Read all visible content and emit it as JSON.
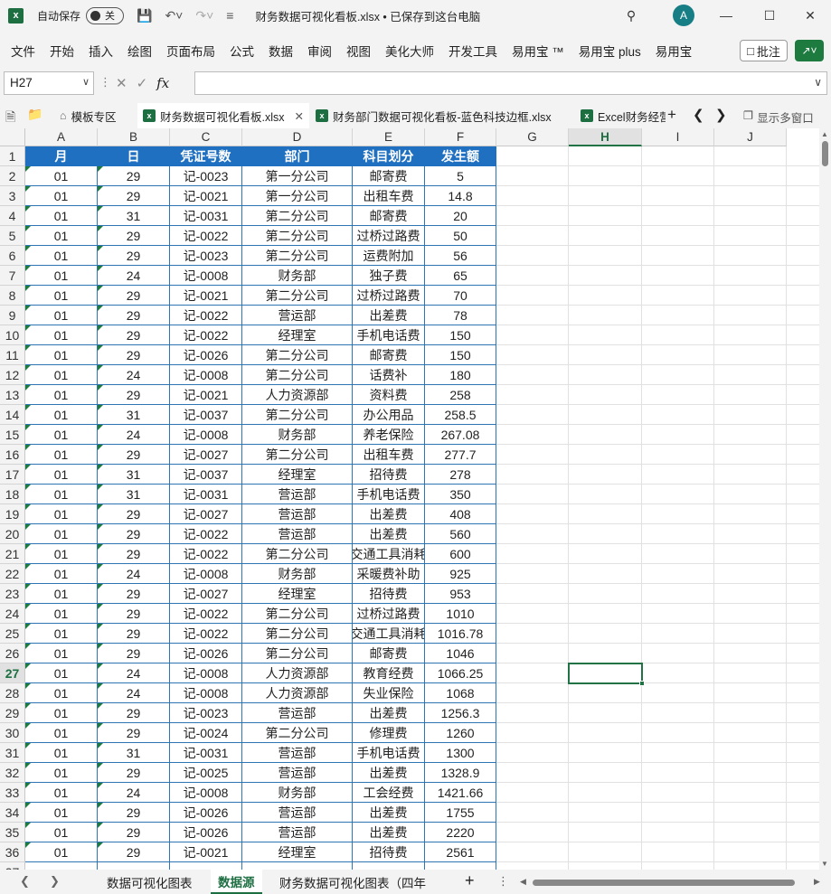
{
  "titlebar": {
    "autosave_label": "自动保存",
    "autosave_state": "关",
    "doc_title": "财务数据可视化看板.xlsx • 已保存到这台电脑",
    "avatar_letter": "A"
  },
  "menu": [
    "文件",
    "开始",
    "插入",
    "绘图",
    "页面布局",
    "公式",
    "数据",
    "审阅",
    "视图",
    "美化大师",
    "开发工具",
    "易用宝 ™",
    "易用宝 plus",
    "易用宝"
  ],
  "comment_label": "批注",
  "namebox": "H27",
  "fx_label": "fx",
  "file_tabs": {
    "template": "模板专区",
    "tab1": "财务数据可视化看板.xlsx",
    "tab2": "财务部门数据可视化看板-蓝色科技边框.xlsx",
    "tab3": "Excel财务经营",
    "multi_window": "显示多窗口"
  },
  "columns": [
    "A",
    "B",
    "C",
    "D",
    "E",
    "F",
    "G",
    "H",
    "I",
    "J"
  ],
  "headers": [
    "月",
    "日",
    "凭证号数",
    "部门",
    "科目划分",
    "发生额"
  ],
  "rows": [
    [
      "01",
      "29",
      "记-0023",
      "第一分公司",
      "邮寄费",
      "5"
    ],
    [
      "01",
      "29",
      "记-0021",
      "第一分公司",
      "出租车费",
      "14.8"
    ],
    [
      "01",
      "31",
      "记-0031",
      "第二分公司",
      "邮寄费",
      "20"
    ],
    [
      "01",
      "29",
      "记-0022",
      "第二分公司",
      "过桥过路费",
      "50"
    ],
    [
      "01",
      "29",
      "记-0023",
      "第二分公司",
      "运费附加",
      "56"
    ],
    [
      "01",
      "24",
      "记-0008",
      "财务部",
      "独子费",
      "65"
    ],
    [
      "01",
      "29",
      "记-0021",
      "第二分公司",
      "过桥过路费",
      "70"
    ],
    [
      "01",
      "29",
      "记-0022",
      "营运部",
      "出差费",
      "78"
    ],
    [
      "01",
      "29",
      "记-0022",
      "经理室",
      "手机电话费",
      "150"
    ],
    [
      "01",
      "29",
      "记-0026",
      "第二分公司",
      "邮寄费",
      "150"
    ],
    [
      "01",
      "24",
      "记-0008",
      "第二分公司",
      "话费补",
      "180"
    ],
    [
      "01",
      "29",
      "记-0021",
      "人力资源部",
      "资料费",
      "258"
    ],
    [
      "01",
      "31",
      "记-0037",
      "第二分公司",
      "办公用品",
      "258.5"
    ],
    [
      "01",
      "24",
      "记-0008",
      "财务部",
      "养老保险",
      "267.08"
    ],
    [
      "01",
      "29",
      "记-0027",
      "第二分公司",
      "出租车费",
      "277.7"
    ],
    [
      "01",
      "31",
      "记-0037",
      "经理室",
      "招待费",
      "278"
    ],
    [
      "01",
      "31",
      "记-0031",
      "营运部",
      "手机电话费",
      "350"
    ],
    [
      "01",
      "29",
      "记-0027",
      "营运部",
      "出差费",
      "408"
    ],
    [
      "01",
      "29",
      "记-0022",
      "营运部",
      "出差费",
      "560"
    ],
    [
      "01",
      "29",
      "记-0022",
      "第二分公司",
      "交通工具消耗",
      "600"
    ],
    [
      "01",
      "24",
      "记-0008",
      "财务部",
      "采暖费补助",
      "925"
    ],
    [
      "01",
      "29",
      "记-0027",
      "经理室",
      "招待费",
      "953"
    ],
    [
      "01",
      "29",
      "记-0022",
      "第二分公司",
      "过桥过路费",
      "1010"
    ],
    [
      "01",
      "29",
      "记-0022",
      "第二分公司",
      "交通工具消耗",
      "1016.78"
    ],
    [
      "01",
      "29",
      "记-0026",
      "第二分公司",
      "邮寄费",
      "1046"
    ],
    [
      "01",
      "24",
      "记-0008",
      "人力资源部",
      "教育经费",
      "1066.25"
    ],
    [
      "01",
      "24",
      "记-0008",
      "人力资源部",
      "失业保险",
      "1068"
    ],
    [
      "01",
      "29",
      "记-0023",
      "营运部",
      "出差费",
      "1256.3"
    ],
    [
      "01",
      "29",
      "记-0024",
      "第二分公司",
      "修理费",
      "1260"
    ],
    [
      "01",
      "31",
      "记-0031",
      "营运部",
      "手机电话费",
      "1300"
    ],
    [
      "01",
      "29",
      "记-0025",
      "营运部",
      "出差费",
      "1328.9"
    ],
    [
      "01",
      "24",
      "记-0008",
      "财务部",
      "工会经费",
      "1421.66"
    ],
    [
      "01",
      "29",
      "记-0026",
      "营运部",
      "出差费",
      "1755"
    ],
    [
      "01",
      "29",
      "记-0026",
      "营运部",
      "出差费",
      "2220"
    ],
    [
      "01",
      "29",
      "记-0021",
      "经理室",
      "招待费",
      "2561"
    ]
  ],
  "sheets": {
    "sheet1": "数据可视化图表",
    "sheet2": "数据源",
    "sheet3": "财务数据可视化图表（四年"
  },
  "colors": {
    "header_fill": "#1f70c1",
    "border": "#2e75b6",
    "excel_green": "#217346"
  }
}
